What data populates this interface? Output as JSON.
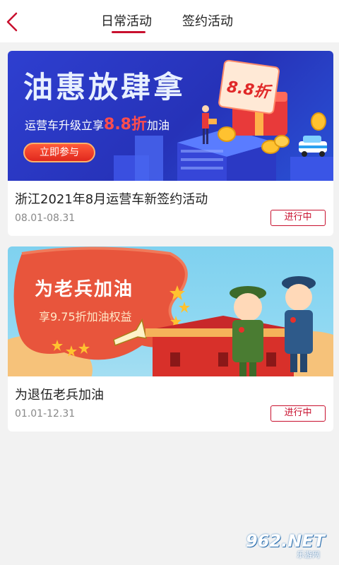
{
  "colors": {
    "accent": "#c8102e",
    "banner1_bg": "#2632b8",
    "banner2_bg": "#8fd8f2"
  },
  "header": {
    "back_icon": "chevron-left-icon",
    "tabs": [
      {
        "label": "日常活动",
        "active": true
      },
      {
        "label": "签约活动",
        "active": false
      }
    ]
  },
  "cards": [
    {
      "title": "浙江2021年8月运营车新签约活动",
      "date_range": "08.01-08.31",
      "status": "进行中",
      "banner": {
        "headline": "油惠放肆拿",
        "sub_prefix": "运营车升级立享",
        "sub_highlight": "8.8折",
        "sub_suffix": "加油",
        "coupon": "8.8折",
        "button": "立即参与"
      }
    },
    {
      "title": "为退伍老兵加油",
      "date_range": "01.01-12.31",
      "status": "进行中",
      "banner": {
        "headline": "为老兵加油",
        "subline": "享9.75折加油权益"
      }
    }
  ],
  "watermark": {
    "main": "962.NET",
    "sub": "乐游网"
  }
}
